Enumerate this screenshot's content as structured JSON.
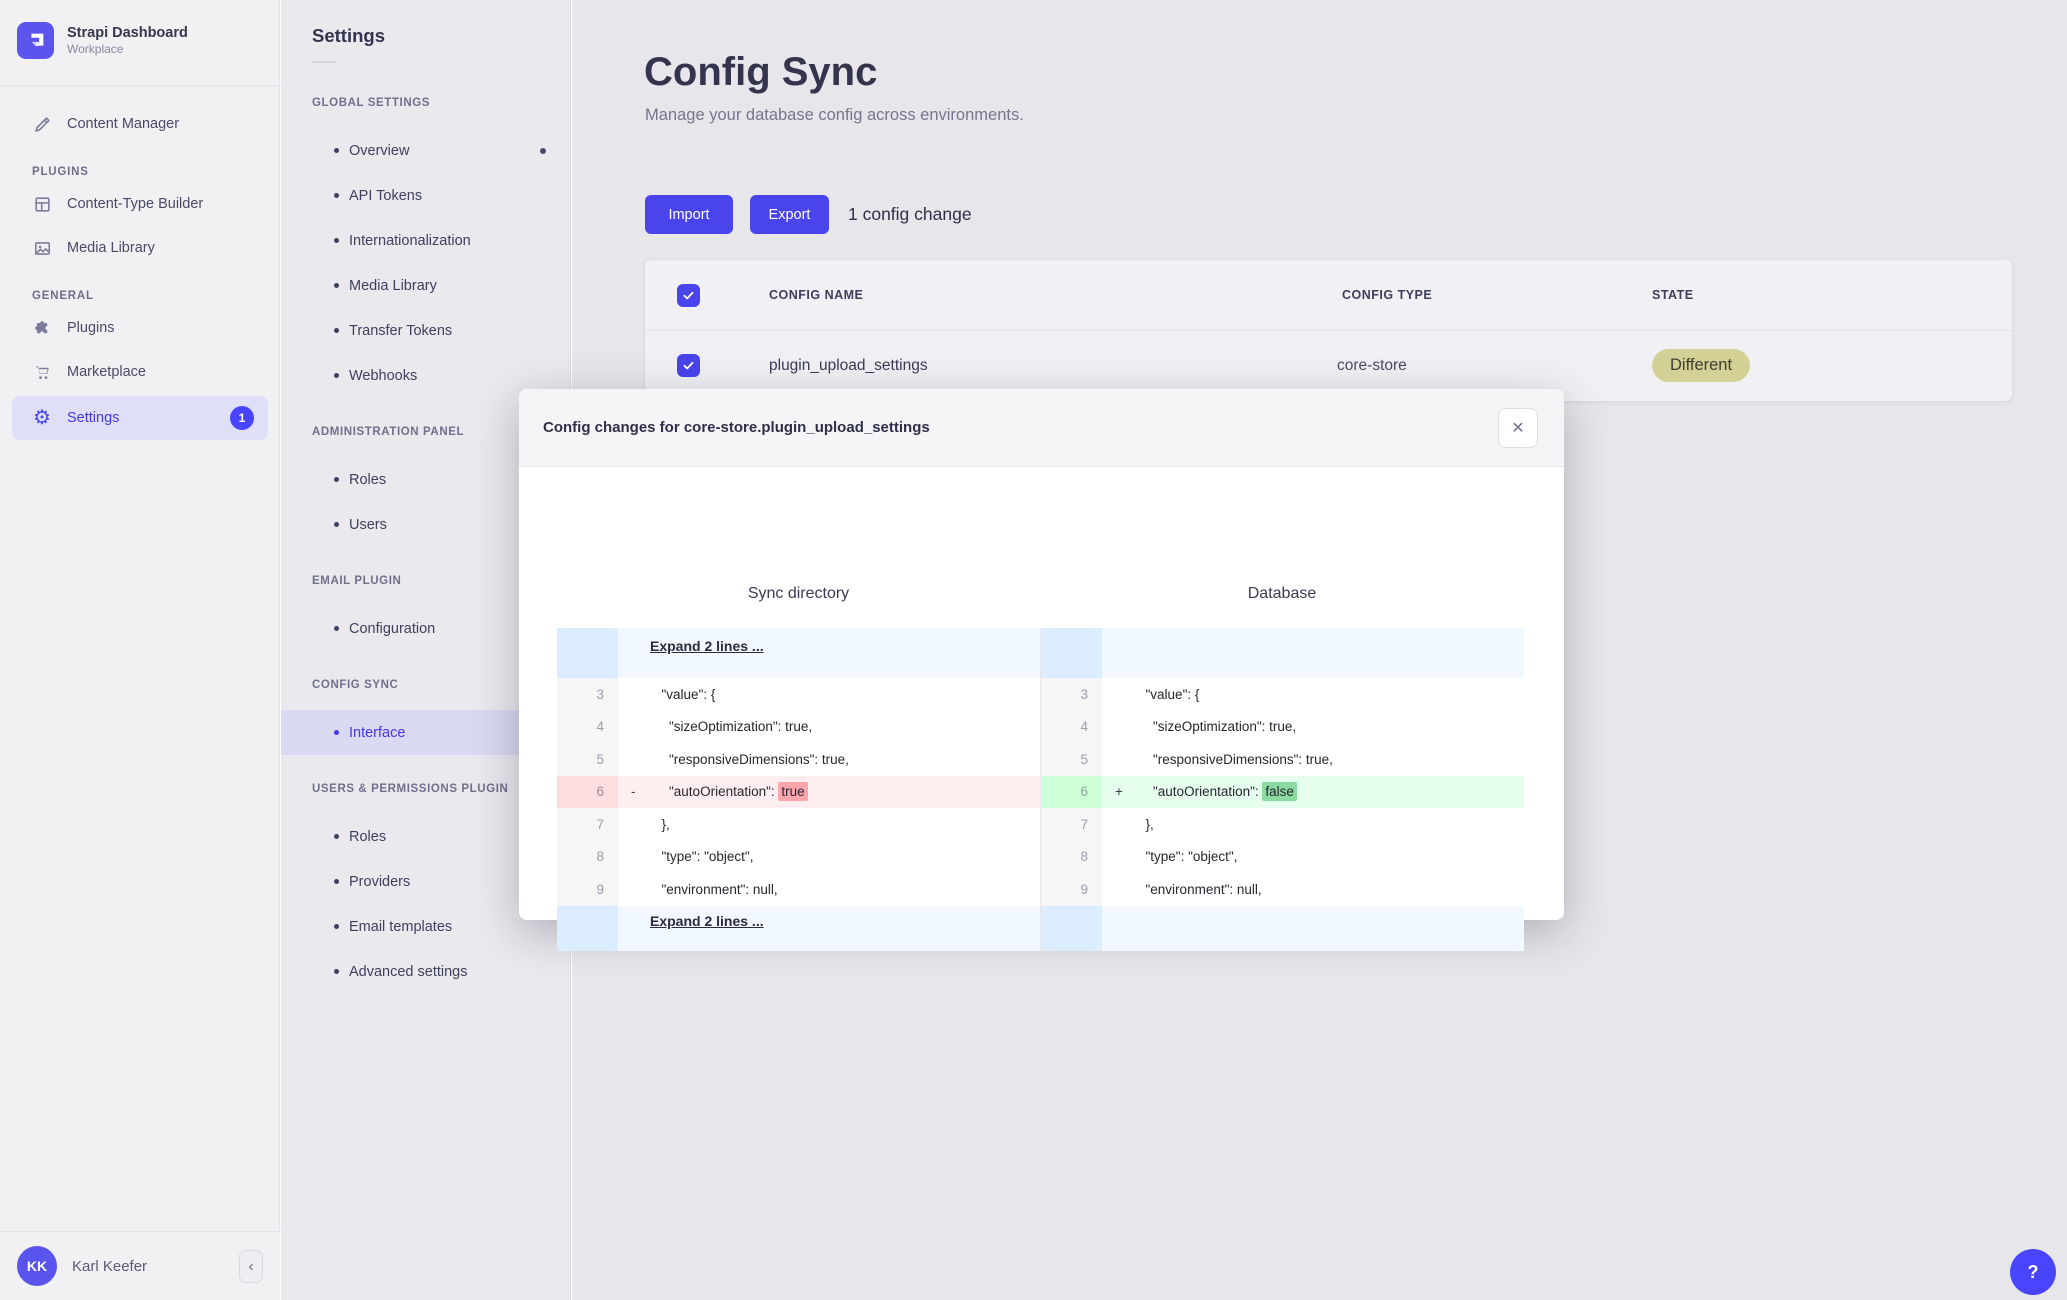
{
  "app": {
    "title": "Strapi Dashboard",
    "workspace": "Workplace"
  },
  "sidebar": {
    "content_manager": "Content Manager",
    "sections": [
      {
        "label": "PLUGINS",
        "items": [
          {
            "label": "Content-Type Builder"
          },
          {
            "label": "Media Library"
          }
        ]
      },
      {
        "label": "GENERAL",
        "items": [
          {
            "label": "Plugins"
          },
          {
            "label": "Marketplace"
          },
          {
            "label": "Settings",
            "badge": "1",
            "active": true
          }
        ]
      }
    ],
    "user": {
      "initials": "KK",
      "name": "Karl Keefer"
    },
    "collapse_icon": "chevron-left"
  },
  "settings_nav": {
    "title": "Settings",
    "sections": [
      {
        "label": "GLOBAL SETTINGS",
        "items": [
          {
            "label": "Overview",
            "dot": true
          },
          {
            "label": "API Tokens"
          },
          {
            "label": "Internationalization"
          },
          {
            "label": "Media Library"
          },
          {
            "label": "Transfer Tokens"
          },
          {
            "label": "Webhooks"
          }
        ]
      },
      {
        "label": "ADMINISTRATION PANEL",
        "items": [
          {
            "label": "Roles"
          },
          {
            "label": "Users"
          }
        ]
      },
      {
        "label": "EMAIL PLUGIN",
        "items": [
          {
            "label": "Configuration"
          }
        ]
      },
      {
        "label": "CONFIG SYNC",
        "items": [
          {
            "label": "Interface",
            "active": true
          }
        ]
      },
      {
        "label": "USERS & PERMISSIONS PLUGIN",
        "items": [
          {
            "label": "Roles"
          },
          {
            "label": "Providers"
          },
          {
            "label": "Email templates"
          },
          {
            "label": "Advanced settings"
          }
        ]
      }
    ]
  },
  "page": {
    "title": "Config Sync",
    "subtitle": "Manage your database config across environments.",
    "import_label": "Import",
    "export_label": "Export",
    "changes_text": "1 config change",
    "table": {
      "headers": {
        "name": "CONFIG NAME",
        "type": "CONFIG TYPE",
        "state": "STATE"
      },
      "row": {
        "name": "plugin_upload_settings",
        "type": "core-store",
        "state": "Different"
      }
    }
  },
  "modal": {
    "title": "Config changes for core-store.plugin_upload_settings",
    "left_title": "Sync directory",
    "right_title": "Database",
    "expand_top": "Expand 2 lines ...",
    "expand_bottom": "Expand 2 lines ...",
    "diff": {
      "lines": [
        {
          "num": 3,
          "text": "  \"value\": {"
        },
        {
          "num": 4,
          "text": "    \"sizeOptimization\": true,"
        },
        {
          "num": 5,
          "text": "    \"responsiveDimensions\": true,"
        },
        {
          "num": 6,
          "changed": true,
          "pre": "    \"autoOrientation\": ",
          "removed": "true",
          "added": "false"
        },
        {
          "num": 7,
          "text": "  },"
        },
        {
          "num": 8,
          "text": "  \"type\": \"object\","
        },
        {
          "num": 9,
          "text": "  \"environment\": null,"
        }
      ]
    }
  },
  "help_label": "?",
  "colors": {
    "accent": "#4945ff",
    "removed_bg": "#ffeef0",
    "added_bg": "#e6ffed",
    "state_badge_bg": "#d3d196"
  }
}
